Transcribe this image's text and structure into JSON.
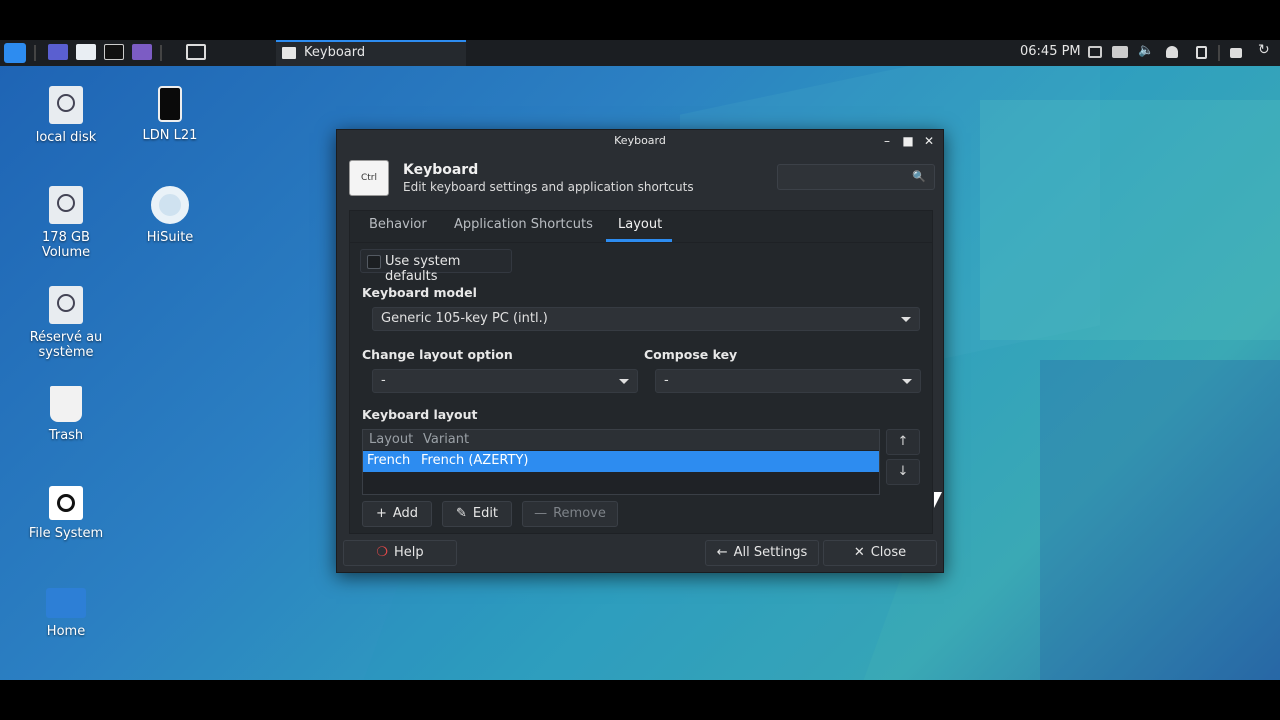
{
  "panel": {
    "taskbar_window_label": "Keyboard",
    "clock": "06:45 PM"
  },
  "desktop_icons": [
    {
      "label": "local disk"
    },
    {
      "label": "LDN L21"
    },
    {
      "label": "178 GB Volume"
    },
    {
      "label": "HiSuite"
    },
    {
      "label": "Réservé au système"
    },
    {
      "label": "Trash"
    },
    {
      "label": "File System"
    },
    {
      "label": "Home"
    }
  ],
  "window": {
    "title": "Keyboard",
    "header_title": "Keyboard",
    "header_subtitle": "Edit keyboard settings and application shortcuts",
    "icon_text": "Ctrl",
    "search_placeholder": "",
    "tabs": [
      {
        "label": "Behavior",
        "active": false
      },
      {
        "label": "Application Shortcuts",
        "active": false
      },
      {
        "label": "Layout",
        "active": true
      }
    ],
    "use_system_defaults": {
      "label": "Use system defaults",
      "checked": false
    },
    "keyboard_model": {
      "label": "Keyboard model",
      "value": "Generic 105-key PC (intl.)"
    },
    "change_layout_option": {
      "label": "Change layout option",
      "value": "-"
    },
    "compose_key": {
      "label": "Compose key",
      "value": "-"
    },
    "keyboard_layout": {
      "label": "Keyboard layout",
      "columns": [
        "Layout",
        "Variant"
      ],
      "rows": [
        {
          "layout": "French",
          "variant": "French (AZERTY)",
          "selected": true
        }
      ]
    },
    "buttons": {
      "add": "Add",
      "edit": "Edit",
      "remove": "Remove",
      "help": "Help",
      "all_settings": "All Settings",
      "close": "Close"
    }
  },
  "colors": {
    "accent": "#2d8cf0",
    "window_bg": "#2a2e33",
    "panel_bg": "#1b1e22"
  }
}
